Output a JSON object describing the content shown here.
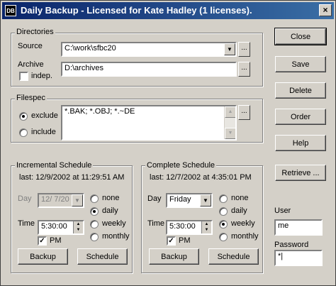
{
  "window": {
    "title": "Daily Backup - Licensed for Kate Hadley (1 licenses).",
    "icon": "DB",
    "close": "×"
  },
  "directories": {
    "group_label": "Directories",
    "source_label": "Source",
    "source_value": "C:\\work\\sfbc20",
    "archive_label": "Archive",
    "archive_value": "D:\\archives",
    "indep_label": "indep.",
    "browse": "..."
  },
  "filespec": {
    "group_label": "Filespec",
    "exclude_label": "exclude",
    "include_label": "include",
    "value": "*.BAK; *.OBJ; *.~DE",
    "browse": "..."
  },
  "incremental": {
    "group_label": "Incremental Schedule",
    "last": "last: 12/9/2002 at 11:29:51 AM",
    "day_label": "Day",
    "day_value": "12/  7/20",
    "time_label": "Time",
    "time_value": "5:30:00",
    "pm_label": "PM",
    "options": [
      "none",
      "daily",
      "weekly",
      "monthly"
    ],
    "backup_btn": "Backup",
    "schedule_btn": "Schedule"
  },
  "complete": {
    "group_label": "Complete Schedule",
    "last": "last: 12/7/2002 at 4:35:01 PM",
    "day_label": "Day",
    "day_value": "Friday",
    "time_label": "Time",
    "time_value": "5:30:00",
    "pm_label": "PM",
    "options": [
      "none",
      "daily",
      "weekly",
      "monthly"
    ],
    "backup_btn": "Backup",
    "schedule_btn": "Schedule"
  },
  "side": {
    "close": "Close",
    "save": "Save",
    "delete": "Delete",
    "order": "Order",
    "help": "Help",
    "retrieve": "Retrieve ...",
    "user_label": "User",
    "user_value": "me",
    "password_label": "Password",
    "password_value": "*|"
  },
  "colors": {
    "titlebar_start": "#0a246a",
    "titlebar_end": "#3a6ea5",
    "face": "#d4d0c8"
  }
}
